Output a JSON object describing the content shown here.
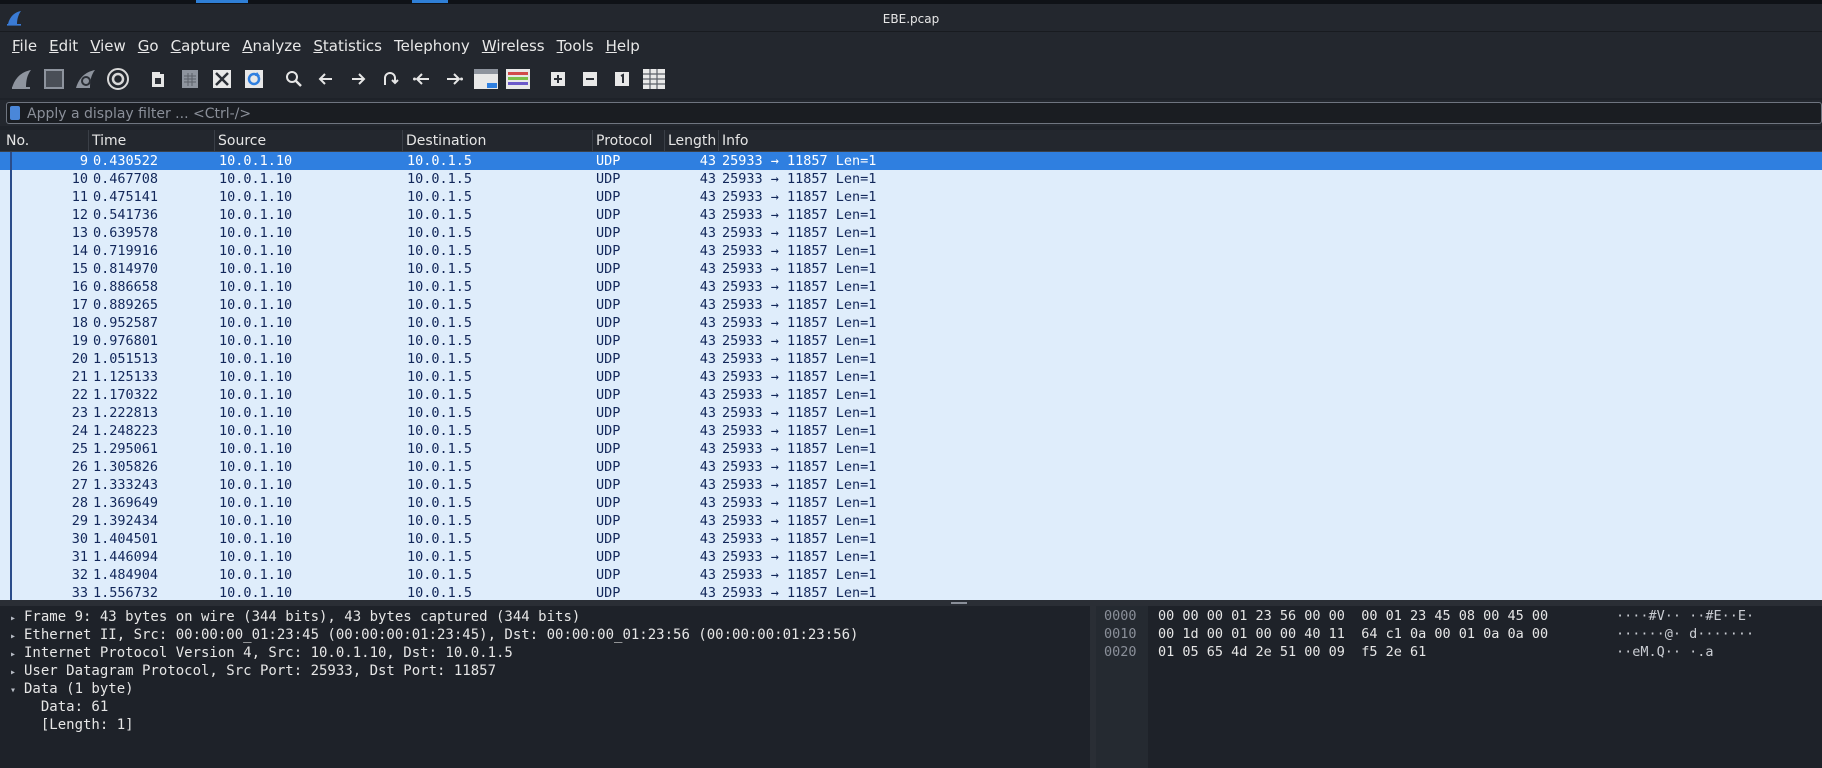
{
  "window": {
    "title": "EBE.pcap",
    "accent_color": "#2f7fe0"
  },
  "menubar": {
    "items": [
      {
        "u": "F",
        "rest": "ile"
      },
      {
        "u": "E",
        "rest": "dit"
      },
      {
        "u": "V",
        "rest": "iew"
      },
      {
        "u": "G",
        "rest": "o"
      },
      {
        "u": "C",
        "rest": "apture"
      },
      {
        "u": "A",
        "rest": "nalyze"
      },
      {
        "u": "S",
        "rest": "tatistics"
      },
      {
        "u": "",
        "rest": "Telephony"
      },
      {
        "u": "W",
        "rest": "ireless"
      },
      {
        "u": "T",
        "rest": "ools"
      },
      {
        "u": "H",
        "rest": "elp"
      }
    ]
  },
  "toolbar": {
    "icons": [
      "start-capture-icon",
      "stop-capture-icon",
      "restart-capture-icon",
      "capture-options-icon",
      "open-file-icon",
      "save-file-icon",
      "close-file-icon",
      "reload-file-icon",
      "find-packet-icon",
      "go-back-icon",
      "go-forward-icon",
      "go-to-packet-icon",
      "first-packet-icon",
      "last-packet-icon",
      "autoscroll-icon",
      "colorize-icon",
      "zoom-in-icon",
      "zoom-out-icon",
      "normal-size-icon",
      "resize-columns-icon"
    ]
  },
  "filter": {
    "placeholder": "Apply a display filter ... <Ctrl-/>"
  },
  "packet_list": {
    "columns": [
      "No.",
      "Time",
      "Source",
      "Destination",
      "Protocol",
      "Length",
      "Info"
    ],
    "rows": [
      {
        "no": "9",
        "time": "0.430522",
        "src": "10.0.1.10",
        "dst": "10.0.1.5",
        "proto": "UDP",
        "len": "43",
        "info": "25933 → 11857 Len=1"
      },
      {
        "no": "10",
        "time": "0.467708",
        "src": "10.0.1.10",
        "dst": "10.0.1.5",
        "proto": "UDP",
        "len": "43",
        "info": "25933 → 11857 Len=1"
      },
      {
        "no": "11",
        "time": "0.475141",
        "src": "10.0.1.10",
        "dst": "10.0.1.5",
        "proto": "UDP",
        "len": "43",
        "info": "25933 → 11857 Len=1"
      },
      {
        "no": "12",
        "time": "0.541736",
        "src": "10.0.1.10",
        "dst": "10.0.1.5",
        "proto": "UDP",
        "len": "43",
        "info": "25933 → 11857 Len=1"
      },
      {
        "no": "13",
        "time": "0.639578",
        "src": "10.0.1.10",
        "dst": "10.0.1.5",
        "proto": "UDP",
        "len": "43",
        "info": "25933 → 11857 Len=1"
      },
      {
        "no": "14",
        "time": "0.719916",
        "src": "10.0.1.10",
        "dst": "10.0.1.5",
        "proto": "UDP",
        "len": "43",
        "info": "25933 → 11857 Len=1"
      },
      {
        "no": "15",
        "time": "0.814970",
        "src": "10.0.1.10",
        "dst": "10.0.1.5",
        "proto": "UDP",
        "len": "43",
        "info": "25933 → 11857 Len=1"
      },
      {
        "no": "16",
        "time": "0.886658",
        "src": "10.0.1.10",
        "dst": "10.0.1.5",
        "proto": "UDP",
        "len": "43",
        "info": "25933 → 11857 Len=1"
      },
      {
        "no": "17",
        "time": "0.889265",
        "src": "10.0.1.10",
        "dst": "10.0.1.5",
        "proto": "UDP",
        "len": "43",
        "info": "25933 → 11857 Len=1"
      },
      {
        "no": "18",
        "time": "0.952587",
        "src": "10.0.1.10",
        "dst": "10.0.1.5",
        "proto": "UDP",
        "len": "43",
        "info": "25933 → 11857 Len=1"
      },
      {
        "no": "19",
        "time": "0.976801",
        "src": "10.0.1.10",
        "dst": "10.0.1.5",
        "proto": "UDP",
        "len": "43",
        "info": "25933 → 11857 Len=1"
      },
      {
        "no": "20",
        "time": "1.051513",
        "src": "10.0.1.10",
        "dst": "10.0.1.5",
        "proto": "UDP",
        "len": "43",
        "info": "25933 → 11857 Len=1"
      },
      {
        "no": "21",
        "time": "1.125133",
        "src": "10.0.1.10",
        "dst": "10.0.1.5",
        "proto": "UDP",
        "len": "43",
        "info": "25933 → 11857 Len=1"
      },
      {
        "no": "22",
        "time": "1.170322",
        "src": "10.0.1.10",
        "dst": "10.0.1.5",
        "proto": "UDP",
        "len": "43",
        "info": "25933 → 11857 Len=1"
      },
      {
        "no": "23",
        "time": "1.222813",
        "src": "10.0.1.10",
        "dst": "10.0.1.5",
        "proto": "UDP",
        "len": "43",
        "info": "25933 → 11857 Len=1"
      },
      {
        "no": "24",
        "time": "1.248223",
        "src": "10.0.1.10",
        "dst": "10.0.1.5",
        "proto": "UDP",
        "len": "43",
        "info": "25933 → 11857 Len=1"
      },
      {
        "no": "25",
        "time": "1.295061",
        "src": "10.0.1.10",
        "dst": "10.0.1.5",
        "proto": "UDP",
        "len": "43",
        "info": "25933 → 11857 Len=1"
      },
      {
        "no": "26",
        "time": "1.305826",
        "src": "10.0.1.10",
        "dst": "10.0.1.5",
        "proto": "UDP",
        "len": "43",
        "info": "25933 → 11857 Len=1"
      },
      {
        "no": "27",
        "time": "1.333243",
        "src": "10.0.1.10",
        "dst": "10.0.1.5",
        "proto": "UDP",
        "len": "43",
        "info": "25933 → 11857 Len=1"
      },
      {
        "no": "28",
        "time": "1.369649",
        "src": "10.0.1.10",
        "dst": "10.0.1.5",
        "proto": "UDP",
        "len": "43",
        "info": "25933 → 11857 Len=1"
      },
      {
        "no": "29",
        "time": "1.392434",
        "src": "10.0.1.10",
        "dst": "10.0.1.5",
        "proto": "UDP",
        "len": "43",
        "info": "25933 → 11857 Len=1"
      },
      {
        "no": "30",
        "time": "1.404501",
        "src": "10.0.1.10",
        "dst": "10.0.1.5",
        "proto": "UDP",
        "len": "43",
        "info": "25933 → 11857 Len=1"
      },
      {
        "no": "31",
        "time": "1.446094",
        "src": "10.0.1.10",
        "dst": "10.0.1.5",
        "proto": "UDP",
        "len": "43",
        "info": "25933 → 11857 Len=1"
      },
      {
        "no": "32",
        "time": "1.484904",
        "src": "10.0.1.10",
        "dst": "10.0.1.5",
        "proto": "UDP",
        "len": "43",
        "info": "25933 → 11857 Len=1"
      },
      {
        "no": "33",
        "time": "1.556732",
        "src": "10.0.1.10",
        "dst": "10.0.1.5",
        "proto": "UDP",
        "len": "43",
        "info": "25933 → 11857 Len=1"
      }
    ]
  },
  "details": {
    "lines": [
      {
        "arrow": "▸",
        "text": "Frame 9: 43 bytes on wire (344 bits), 43 bytes captured (344 bits)"
      },
      {
        "arrow": "▸",
        "text": "Ethernet II, Src: 00:00:00_01:23:45 (00:00:00:01:23:45), Dst: 00:00:00_01:23:56 (00:00:00:01:23:56)"
      },
      {
        "arrow": "▸",
        "text": "Internet Protocol Version 4, Src: 10.0.1.10, Dst: 10.0.1.5"
      },
      {
        "arrow": "▸",
        "text": "User Datagram Protocol, Src Port: 25933, Dst Port: 11857"
      },
      {
        "arrow": "▾",
        "text": "Data (1 byte)"
      },
      {
        "arrow": "",
        "text": "  Data: 61"
      },
      {
        "arrow": "",
        "text": "  [Length: 1]"
      }
    ]
  },
  "hex": {
    "lines": [
      {
        "offset": "0000",
        "bytes": "00 00 00 01 23 56 00 00  00 01 23 45 08 00 45 00",
        "ascii": "····#V·· ··#E··E·"
      },
      {
        "offset": "0010",
        "bytes": "00 1d 00 01 00 00 40 11  64 c1 0a 00 01 0a 0a 00",
        "ascii": "······@· d·······"
      },
      {
        "offset": "0020",
        "bytes": "01 05 65 4d 2e 51 00 09  f5 2e 61",
        "ascii": "··eM.Q·· ·.a"
      }
    ]
  }
}
